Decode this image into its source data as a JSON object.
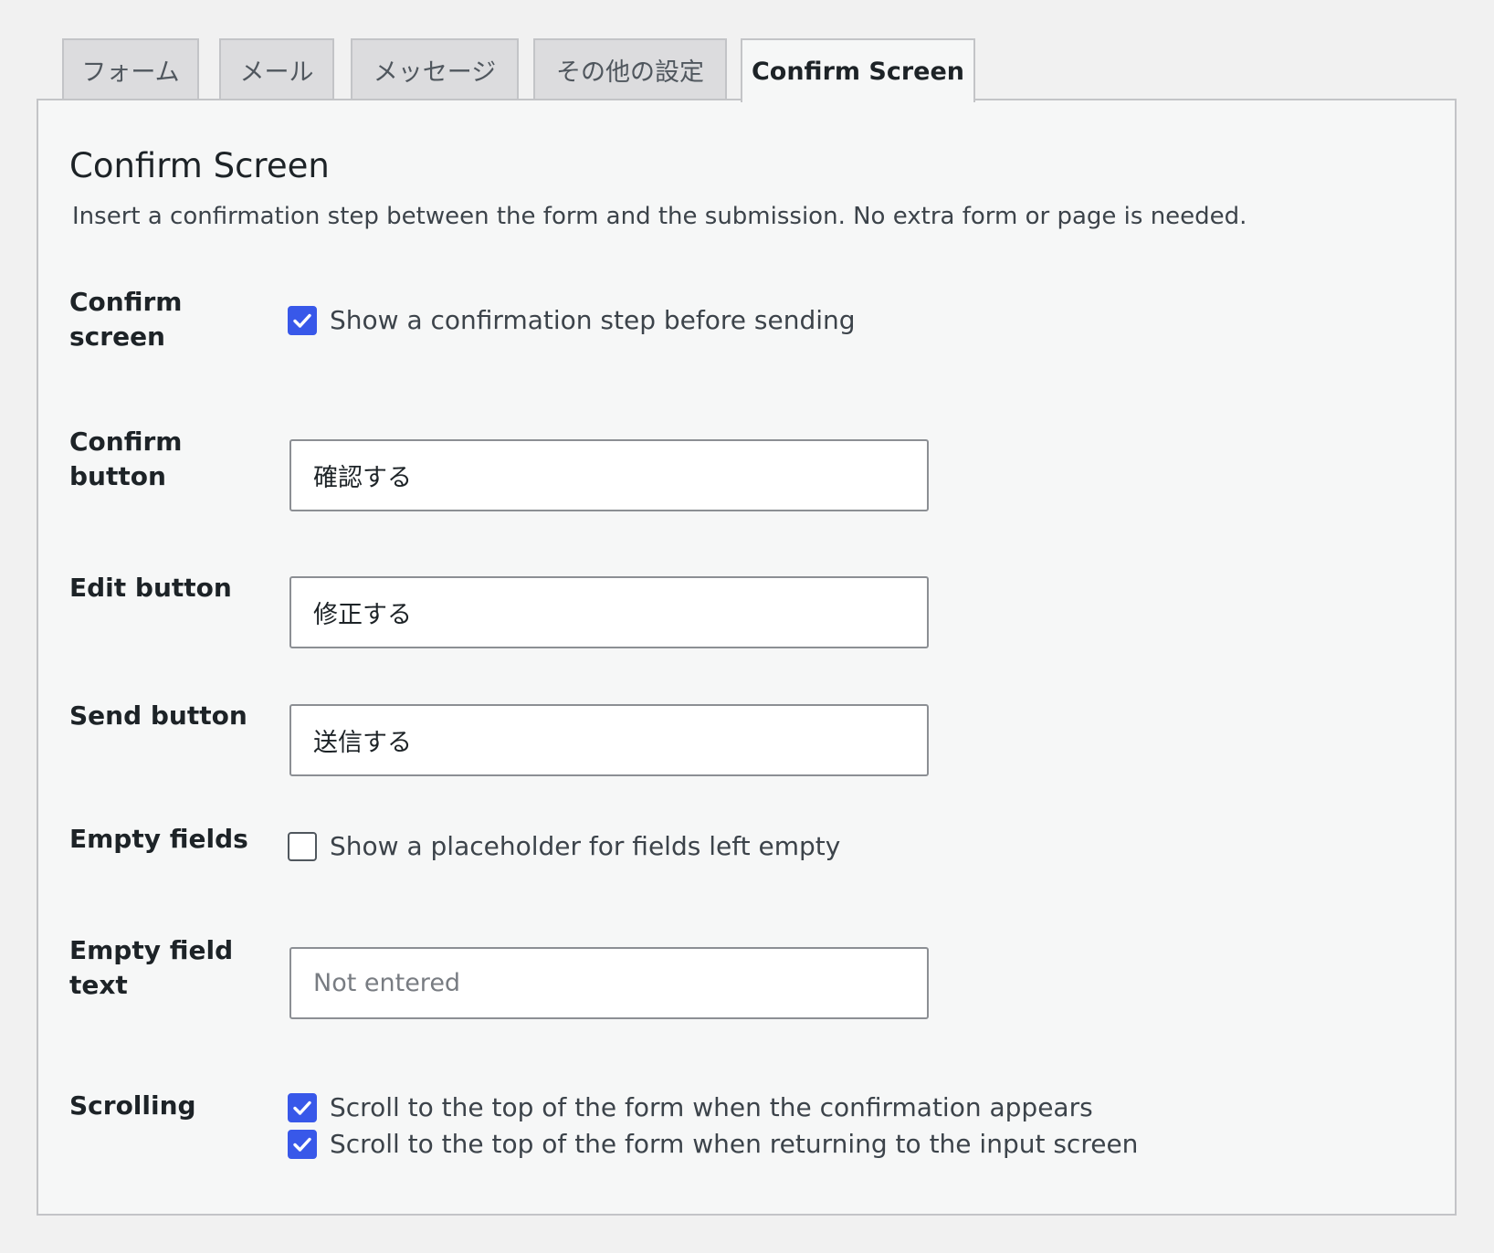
{
  "tabs": [
    {
      "label": "フォーム",
      "active": false
    },
    {
      "label": "メール",
      "active": false
    },
    {
      "label": "メッセージ",
      "active": false
    },
    {
      "label": "その他の設定",
      "active": false
    },
    {
      "label": "Confirm Screen",
      "active": true
    }
  ],
  "panel": {
    "title": "Confirm Screen",
    "description": "Insert a confirmation step between the form and the submission. No extra form or page is needed."
  },
  "settings": {
    "confirm_screen": {
      "label_line1": "Confirm",
      "label_line2": "screen",
      "checkbox_label": "Show a confirmation step before sending",
      "checked": true
    },
    "confirm_button": {
      "label_line1": "Confirm",
      "label_line2": "button",
      "value": "確認する"
    },
    "edit_button": {
      "label": "Edit button",
      "value": "修正する"
    },
    "send_button": {
      "label": "Send button",
      "value": "送信する"
    },
    "empty_fields": {
      "label": "Empty fields",
      "checkbox_label": "Show a placeholder for fields left empty",
      "checked": false
    },
    "empty_field_text": {
      "label_line1": "Empty field",
      "label_line2": "text",
      "value": "",
      "placeholder": "Not entered"
    },
    "scrolling": {
      "label": "Scrolling",
      "options": [
        {
          "label": "Scroll to the top of the form when the confirmation appears",
          "checked": true
        },
        {
          "label": "Scroll to the top of the form when returning to the input screen",
          "checked": true
        }
      ]
    }
  },
  "colors": {
    "checkbox_accent": "#3858e9",
    "panel_background": "#f6f7f7",
    "tab_inactive": "#dcdcde"
  }
}
